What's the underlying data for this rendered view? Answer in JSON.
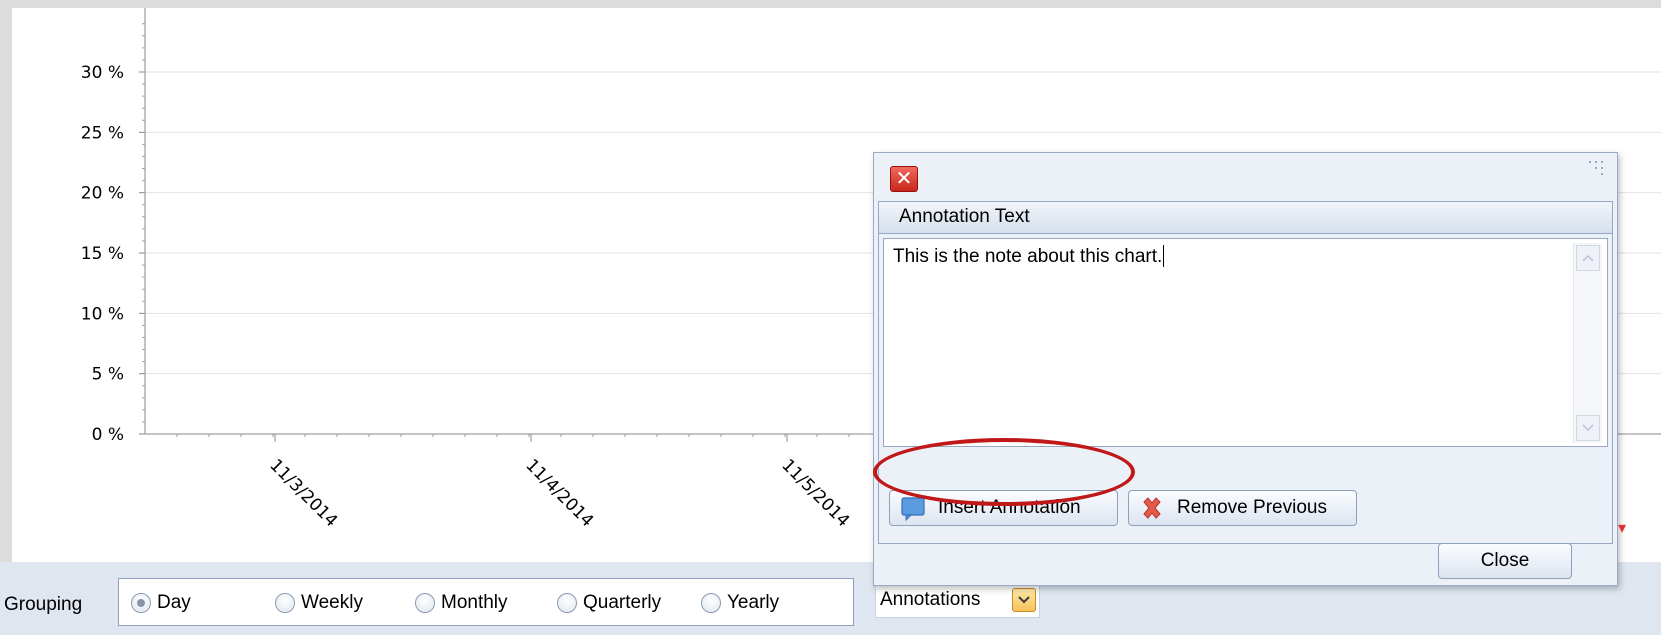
{
  "chart": {
    "y_ticks": [
      "30 %",
      "25 %",
      "20 %",
      "15 %",
      "10 %",
      "5 %",
      "0 %"
    ],
    "x_ticks": [
      "11/3/2014",
      "11/4/2014",
      "11/5/2014"
    ]
  },
  "chart_data": {
    "type": "line",
    "title": "",
    "xlabel": "",
    "ylabel": "",
    "x": [
      "11/3/2014",
      "11/4/2014",
      "11/5/2014"
    ],
    "y_tick_labels": [
      "0 %",
      "5 %",
      "10 %",
      "15 %",
      "20 %",
      "25 %",
      "30 %"
    ],
    "ylim": [
      0,
      35
    ],
    "grid": true,
    "series": []
  },
  "grouping": {
    "label": "Grouping",
    "options": [
      {
        "label": "Day",
        "checked": true
      },
      {
        "label": "Weekly",
        "checked": false
      },
      {
        "label": "Monthly",
        "checked": false
      },
      {
        "label": "Quarterly",
        "checked": false
      },
      {
        "label": "Yearly",
        "checked": false
      }
    ]
  },
  "annotations": {
    "label": "Annotations",
    "dropdown_icon": "chevron-down-icon"
  },
  "dialog": {
    "close_icon": "close-icon",
    "section_title": "Annotation Text",
    "text_value": "This is the note about this chart.",
    "insert_label": "Insert Annotation",
    "remove_label": "Remove Previous",
    "close_label": "Close",
    "colors": {
      "highlight": "#c01818",
      "close_red": "#c9261b"
    }
  }
}
